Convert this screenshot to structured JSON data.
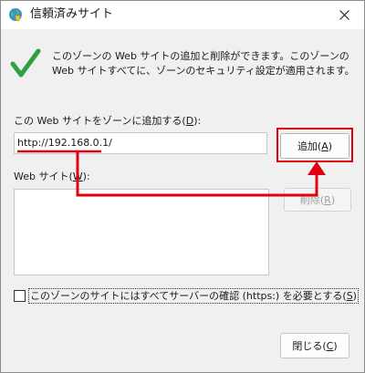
{
  "window": {
    "title": "信頼済みサイト"
  },
  "info": {
    "text": "このゾーンの Web サイトの追加と削除ができます。このゾーンの Web サイトすべてに、ゾーンのセキュリティ設定が適用されます。"
  },
  "add_zone": {
    "label_prefix": "この Web サイトをゾーンに追加する(",
    "label_key": "D",
    "label_suffix": "):",
    "input_value": "http://192.168.0.1/"
  },
  "buttons": {
    "add_prefix": "追加(",
    "add_key": "A",
    "add_suffix": ")",
    "remove_prefix": "削除(",
    "remove_key": "R",
    "remove_suffix": ")",
    "close_prefix": "閉じる(",
    "close_key": "C",
    "close_suffix": ")"
  },
  "sites": {
    "label_prefix": "Web サイト(",
    "label_key": "W",
    "label_suffix": "):",
    "items": []
  },
  "https_option": {
    "label_prefix": "このゾーンのサイトにはすべてサーバーの確認 (https:) を必要とする(",
    "label_key": "S",
    "label_suffix": ")",
    "checked": false
  },
  "colors": {
    "annotation_red": "#e00012",
    "check_green": "#2ea043"
  },
  "icons": {
    "app": "globe-shield-icon",
    "close": "close-icon",
    "check": "checkmark-icon"
  }
}
